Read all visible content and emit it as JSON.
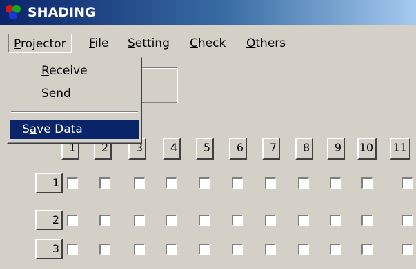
{
  "window": {
    "title": "SHADING"
  },
  "menubar": {
    "items": [
      {
        "pre": "",
        "key": "P",
        "post": "rojector",
        "open": true
      },
      {
        "pre": "",
        "key": "F",
        "post": "ile"
      },
      {
        "pre": "",
        "key": "S",
        "post": "etting"
      },
      {
        "pre": "",
        "key": "C",
        "post": "heck"
      },
      {
        "pre": "",
        "key": "O",
        "post": "thers"
      }
    ]
  },
  "projector_menu": {
    "items": [
      {
        "pre": "",
        "key": "R",
        "post": "eceive"
      },
      {
        "pre": "",
        "key": "S",
        "post": "end"
      },
      {
        "pre": "S",
        "key": "a",
        "post": "ve Data",
        "highlighted": true
      }
    ]
  },
  "grid": {
    "columns": [
      "1",
      "2",
      "3",
      "4",
      "5",
      "6",
      "7",
      "8",
      "9",
      "10",
      "11"
    ],
    "rows": [
      "1",
      "2",
      "3"
    ]
  },
  "colors": {
    "title_gradient_start": "#0a246a",
    "title_gradient_end": "#a6caf0",
    "menu_highlight": "#0a246a",
    "face": "#d4d0c8"
  }
}
